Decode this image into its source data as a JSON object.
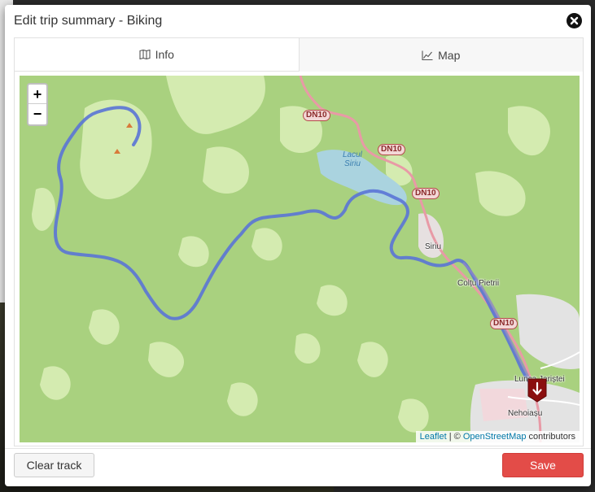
{
  "modal": {
    "title": "Edit trip summary - Biking"
  },
  "tabs": [
    {
      "label": "Info",
      "icon": "map-book-icon",
      "active": false
    },
    {
      "label": "Map",
      "icon": "chart-line-icon",
      "active": true
    }
  ],
  "map": {
    "zoom_in_label": "+",
    "zoom_out_label": "−",
    "labels": {
      "lake": "Lacul\nSiriu",
      "siriu": "Siriu",
      "coltu_pietrii": "Colțu Pietrii",
      "lunca_jariștei": "Lunca Jariștei",
      "nehoiasu": "Nehoiașu"
    },
    "road_shields": [
      "DN10",
      "DN10",
      "DN10",
      "DN10"
    ],
    "attribution": {
      "leaflet": "Leaflet",
      "separator": " | © ",
      "osm": "OpenStreetMap",
      "suffix": " contributors"
    },
    "colors": {
      "track": "#5a74d6",
      "marker": "#8b0f0f",
      "forest": "#a9d17f",
      "meadow": "#d4ebb0",
      "water": "#aad3df",
      "road": "#e89aa6"
    }
  },
  "footer": {
    "clear_label": "Clear track",
    "save_label": "Save"
  }
}
